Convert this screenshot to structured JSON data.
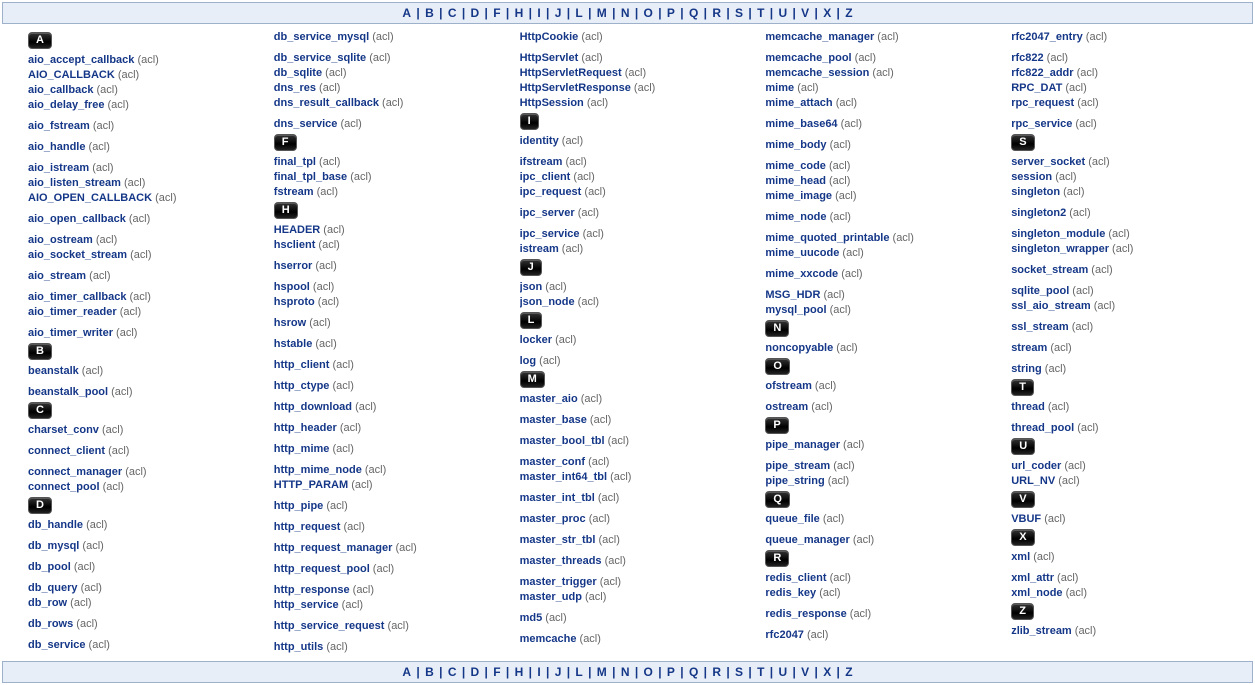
{
  "nav_letters": [
    "A",
    "B",
    "C",
    "D",
    "F",
    "H",
    "I",
    "J",
    "L",
    "M",
    "N",
    "O",
    "P",
    "Q",
    "R",
    "S",
    "T",
    "U",
    "V",
    "X",
    "Z"
  ],
  "columns": [
    [
      {
        "type": "letter",
        "text": "A"
      },
      {
        "type": "entry",
        "name": "aio_accept_callback",
        "ns": "acl"
      },
      {
        "type": "entry",
        "name": "AIO_CALLBACK",
        "ns": "acl"
      },
      {
        "type": "entry",
        "name": "aio_callback",
        "ns": "acl"
      },
      {
        "type": "entry",
        "name": "aio_delay_free",
        "ns": "acl"
      },
      {
        "type": "spacer"
      },
      {
        "type": "entry",
        "name": "aio_fstream",
        "ns": "acl"
      },
      {
        "type": "spacer"
      },
      {
        "type": "entry",
        "name": "aio_handle",
        "ns": "acl"
      },
      {
        "type": "spacer"
      },
      {
        "type": "entry",
        "name": "aio_istream",
        "ns": "acl"
      },
      {
        "type": "entry",
        "name": "aio_listen_stream",
        "ns": "acl"
      },
      {
        "type": "entry",
        "name": "AIO_OPEN_CALLBACK",
        "ns": "acl"
      },
      {
        "type": "spacer"
      },
      {
        "type": "entry",
        "name": "aio_open_callback",
        "ns": "acl"
      },
      {
        "type": "spacer"
      },
      {
        "type": "entry",
        "name": "aio_ostream",
        "ns": "acl"
      },
      {
        "type": "entry",
        "name": "aio_socket_stream",
        "ns": "acl"
      },
      {
        "type": "spacer"
      },
      {
        "type": "entry",
        "name": "aio_stream",
        "ns": "acl"
      },
      {
        "type": "spacer"
      },
      {
        "type": "entry",
        "name": "aio_timer_callback",
        "ns": "acl"
      },
      {
        "type": "entry",
        "name": "aio_timer_reader",
        "ns": "acl"
      },
      {
        "type": "spacer"
      },
      {
        "type": "entry",
        "name": "aio_timer_writer",
        "ns": "acl"
      },
      {
        "type": "letter",
        "text": "B"
      },
      {
        "type": "entry",
        "name": "beanstalk",
        "ns": "acl"
      },
      {
        "type": "spacer"
      },
      {
        "type": "entry",
        "name": "beanstalk_pool",
        "ns": "acl"
      },
      {
        "type": "letter",
        "text": "C"
      },
      {
        "type": "entry",
        "name": "charset_conv",
        "ns": "acl"
      },
      {
        "type": "spacer"
      },
      {
        "type": "entry",
        "name": "connect_client",
        "ns": "acl"
      },
      {
        "type": "spacer"
      },
      {
        "type": "entry",
        "name": "connect_manager",
        "ns": "acl"
      },
      {
        "type": "entry",
        "name": "connect_pool",
        "ns": "acl"
      },
      {
        "type": "letter",
        "text": "D"
      },
      {
        "type": "entry",
        "name": "db_handle",
        "ns": "acl"
      },
      {
        "type": "spacer"
      },
      {
        "type": "entry",
        "name": "db_mysql",
        "ns": "acl"
      },
      {
        "type": "spacer"
      },
      {
        "type": "entry",
        "name": "db_pool",
        "ns": "acl"
      },
      {
        "type": "spacer"
      },
      {
        "type": "entry",
        "name": "db_query",
        "ns": "acl"
      },
      {
        "type": "entry",
        "name": "db_row",
        "ns": "acl"
      },
      {
        "type": "spacer"
      },
      {
        "type": "entry",
        "name": "db_rows",
        "ns": "acl"
      },
      {
        "type": "spacer"
      },
      {
        "type": "entry",
        "name": "db_service",
        "ns": "acl"
      }
    ],
    [
      {
        "type": "entry",
        "name": "db_service_mysql",
        "ns": "acl"
      },
      {
        "type": "spacer"
      },
      {
        "type": "entry",
        "name": "db_service_sqlite",
        "ns": "acl"
      },
      {
        "type": "entry",
        "name": "db_sqlite",
        "ns": "acl"
      },
      {
        "type": "entry",
        "name": "dns_res",
        "ns": "acl"
      },
      {
        "type": "entry",
        "name": "dns_result_callback",
        "ns": "acl"
      },
      {
        "type": "spacer"
      },
      {
        "type": "entry",
        "name": "dns_service",
        "ns": "acl"
      },
      {
        "type": "letter",
        "text": "F"
      },
      {
        "type": "entry",
        "name": "final_tpl",
        "ns": "acl"
      },
      {
        "type": "entry",
        "name": "final_tpl_base",
        "ns": "acl"
      },
      {
        "type": "entry",
        "name": "fstream",
        "ns": "acl"
      },
      {
        "type": "letter",
        "text": "H"
      },
      {
        "type": "entry",
        "name": "HEADER",
        "ns": "acl"
      },
      {
        "type": "entry",
        "name": "hsclient",
        "ns": "acl"
      },
      {
        "type": "spacer"
      },
      {
        "type": "entry",
        "name": "hserror",
        "ns": "acl"
      },
      {
        "type": "spacer"
      },
      {
        "type": "entry",
        "name": "hspool",
        "ns": "acl"
      },
      {
        "type": "entry",
        "name": "hsproto",
        "ns": "acl"
      },
      {
        "type": "spacer"
      },
      {
        "type": "entry",
        "name": "hsrow",
        "ns": "acl"
      },
      {
        "type": "spacer"
      },
      {
        "type": "entry",
        "name": "hstable",
        "ns": "acl"
      },
      {
        "type": "spacer"
      },
      {
        "type": "entry",
        "name": "http_client",
        "ns": "acl"
      },
      {
        "type": "spacer"
      },
      {
        "type": "entry",
        "name": "http_ctype",
        "ns": "acl"
      },
      {
        "type": "spacer"
      },
      {
        "type": "entry",
        "name": "http_download",
        "ns": "acl"
      },
      {
        "type": "spacer"
      },
      {
        "type": "entry",
        "name": "http_header",
        "ns": "acl"
      },
      {
        "type": "spacer"
      },
      {
        "type": "entry",
        "name": "http_mime",
        "ns": "acl"
      },
      {
        "type": "spacer"
      },
      {
        "type": "entry",
        "name": "http_mime_node",
        "ns": "acl"
      },
      {
        "type": "entry",
        "name": "HTTP_PARAM",
        "ns": "acl"
      },
      {
        "type": "spacer"
      },
      {
        "type": "entry",
        "name": "http_pipe",
        "ns": "acl"
      },
      {
        "type": "spacer"
      },
      {
        "type": "entry",
        "name": "http_request",
        "ns": "acl"
      },
      {
        "type": "spacer"
      },
      {
        "type": "entry",
        "name": "http_request_manager",
        "ns": "acl"
      },
      {
        "type": "spacer"
      },
      {
        "type": "entry",
        "name": "http_request_pool",
        "ns": "acl"
      },
      {
        "type": "spacer"
      },
      {
        "type": "entry",
        "name": "http_response",
        "ns": "acl"
      },
      {
        "type": "entry",
        "name": "http_service",
        "ns": "acl"
      },
      {
        "type": "spacer"
      },
      {
        "type": "entry",
        "name": "http_service_request",
        "ns": "acl"
      },
      {
        "type": "spacer"
      },
      {
        "type": "entry",
        "name": "http_utils",
        "ns": "acl"
      }
    ],
    [
      {
        "type": "entry",
        "name": "HttpCookie",
        "ns": "acl"
      },
      {
        "type": "spacer"
      },
      {
        "type": "entry",
        "name": "HttpServlet",
        "ns": "acl"
      },
      {
        "type": "entry",
        "name": "HttpServletRequest",
        "ns": "acl"
      },
      {
        "type": "entry",
        "name": "HttpServletResponse",
        "ns": "acl"
      },
      {
        "type": "entry",
        "name": "HttpSession",
        "ns": "acl"
      },
      {
        "type": "letter",
        "text": "I"
      },
      {
        "type": "entry",
        "name": "identity",
        "ns": "acl"
      },
      {
        "type": "spacer"
      },
      {
        "type": "entry",
        "name": "ifstream",
        "ns": "acl"
      },
      {
        "type": "entry",
        "name": "ipc_client",
        "ns": "acl"
      },
      {
        "type": "entry",
        "name": "ipc_request",
        "ns": "acl"
      },
      {
        "type": "spacer"
      },
      {
        "type": "entry",
        "name": "ipc_server",
        "ns": "acl"
      },
      {
        "type": "spacer"
      },
      {
        "type": "entry",
        "name": "ipc_service",
        "ns": "acl"
      },
      {
        "type": "entry",
        "name": "istream",
        "ns": "acl"
      },
      {
        "type": "letter",
        "text": "J"
      },
      {
        "type": "entry",
        "name": "json",
        "ns": "acl"
      },
      {
        "type": "entry",
        "name": "json_node",
        "ns": "acl"
      },
      {
        "type": "letter",
        "text": "L"
      },
      {
        "type": "entry",
        "name": "locker",
        "ns": "acl"
      },
      {
        "type": "spacer"
      },
      {
        "type": "entry",
        "name": "log",
        "ns": "acl"
      },
      {
        "type": "letter",
        "text": "M"
      },
      {
        "type": "entry",
        "name": "master_aio",
        "ns": "acl"
      },
      {
        "type": "spacer"
      },
      {
        "type": "entry",
        "name": "master_base",
        "ns": "acl"
      },
      {
        "type": "spacer"
      },
      {
        "type": "entry",
        "name": "master_bool_tbl",
        "ns": "acl"
      },
      {
        "type": "spacer"
      },
      {
        "type": "entry",
        "name": "master_conf",
        "ns": "acl"
      },
      {
        "type": "entry",
        "name": "master_int64_tbl",
        "ns": "acl"
      },
      {
        "type": "spacer"
      },
      {
        "type": "entry",
        "name": "master_int_tbl",
        "ns": "acl"
      },
      {
        "type": "spacer"
      },
      {
        "type": "entry",
        "name": "master_proc",
        "ns": "acl"
      },
      {
        "type": "spacer"
      },
      {
        "type": "entry",
        "name": "master_str_tbl",
        "ns": "acl"
      },
      {
        "type": "spacer"
      },
      {
        "type": "entry",
        "name": "master_threads",
        "ns": "acl"
      },
      {
        "type": "spacer"
      },
      {
        "type": "entry",
        "name": "master_trigger",
        "ns": "acl"
      },
      {
        "type": "entry",
        "name": "master_udp",
        "ns": "acl"
      },
      {
        "type": "spacer"
      },
      {
        "type": "entry",
        "name": "md5",
        "ns": "acl"
      },
      {
        "type": "spacer"
      },
      {
        "type": "entry",
        "name": "memcache",
        "ns": "acl"
      }
    ],
    [
      {
        "type": "entry",
        "name": "memcache_manager",
        "ns": "acl"
      },
      {
        "type": "spacer"
      },
      {
        "type": "entry",
        "name": "memcache_pool",
        "ns": "acl"
      },
      {
        "type": "entry",
        "name": "memcache_session",
        "ns": "acl"
      },
      {
        "type": "entry",
        "name": "mime",
        "ns": "acl"
      },
      {
        "type": "entry",
        "name": "mime_attach",
        "ns": "acl"
      },
      {
        "type": "spacer"
      },
      {
        "type": "entry",
        "name": "mime_base64",
        "ns": "acl"
      },
      {
        "type": "spacer"
      },
      {
        "type": "entry",
        "name": "mime_body",
        "ns": "acl"
      },
      {
        "type": "spacer"
      },
      {
        "type": "entry",
        "name": "mime_code",
        "ns": "acl"
      },
      {
        "type": "entry",
        "name": "mime_head",
        "ns": "acl"
      },
      {
        "type": "entry",
        "name": "mime_image",
        "ns": "acl"
      },
      {
        "type": "spacer"
      },
      {
        "type": "entry",
        "name": "mime_node",
        "ns": "acl"
      },
      {
        "type": "spacer"
      },
      {
        "type": "entry",
        "name": "mime_quoted_printable",
        "ns": "acl"
      },
      {
        "type": "entry",
        "name": "mime_uucode",
        "ns": "acl"
      },
      {
        "type": "spacer"
      },
      {
        "type": "entry",
        "name": "mime_xxcode",
        "ns": "acl"
      },
      {
        "type": "spacer"
      },
      {
        "type": "entry",
        "name": "MSG_HDR",
        "ns": "acl"
      },
      {
        "type": "entry",
        "name": "mysql_pool",
        "ns": "acl"
      },
      {
        "type": "letter",
        "text": "N"
      },
      {
        "type": "entry",
        "name": "noncopyable",
        "ns": "acl"
      },
      {
        "type": "letter",
        "text": "O"
      },
      {
        "type": "entry",
        "name": "ofstream",
        "ns": "acl"
      },
      {
        "type": "spacer"
      },
      {
        "type": "entry",
        "name": "ostream",
        "ns": "acl"
      },
      {
        "type": "letter",
        "text": "P"
      },
      {
        "type": "entry",
        "name": "pipe_manager",
        "ns": "acl"
      },
      {
        "type": "spacer"
      },
      {
        "type": "entry",
        "name": "pipe_stream",
        "ns": "acl"
      },
      {
        "type": "entry",
        "name": "pipe_string",
        "ns": "acl"
      },
      {
        "type": "letter",
        "text": "Q"
      },
      {
        "type": "entry",
        "name": "queue_file",
        "ns": "acl"
      },
      {
        "type": "spacer"
      },
      {
        "type": "entry",
        "name": "queue_manager",
        "ns": "acl"
      },
      {
        "type": "letter",
        "text": "R"
      },
      {
        "type": "entry",
        "name": "redis_client",
        "ns": "acl"
      },
      {
        "type": "entry",
        "name": "redis_key",
        "ns": "acl"
      },
      {
        "type": "spacer"
      },
      {
        "type": "entry",
        "name": "redis_response",
        "ns": "acl"
      },
      {
        "type": "spacer"
      },
      {
        "type": "entry",
        "name": "rfc2047",
        "ns": "acl"
      }
    ],
    [
      {
        "type": "entry",
        "name": "rfc2047_entry",
        "ns": "acl"
      },
      {
        "type": "spacer"
      },
      {
        "type": "entry",
        "name": "rfc822",
        "ns": "acl"
      },
      {
        "type": "entry",
        "name": "rfc822_addr",
        "ns": "acl"
      },
      {
        "type": "entry",
        "name": "RPC_DAT",
        "ns": "acl"
      },
      {
        "type": "entry",
        "name": "rpc_request",
        "ns": "acl"
      },
      {
        "type": "spacer"
      },
      {
        "type": "entry",
        "name": "rpc_service",
        "ns": "acl"
      },
      {
        "type": "letter",
        "text": "S"
      },
      {
        "type": "entry",
        "name": "server_socket",
        "ns": "acl"
      },
      {
        "type": "entry",
        "name": "session",
        "ns": "acl"
      },
      {
        "type": "entry",
        "name": "singleton",
        "ns": "acl"
      },
      {
        "type": "spacer"
      },
      {
        "type": "entry",
        "name": "singleton2",
        "ns": "acl"
      },
      {
        "type": "spacer"
      },
      {
        "type": "entry",
        "name": "singleton_module",
        "ns": "acl"
      },
      {
        "type": "entry",
        "name": "singleton_wrapper",
        "ns": "acl"
      },
      {
        "type": "spacer"
      },
      {
        "type": "entry",
        "name": "socket_stream",
        "ns": "acl"
      },
      {
        "type": "spacer"
      },
      {
        "type": "entry",
        "name": "sqlite_pool",
        "ns": "acl"
      },
      {
        "type": "entry",
        "name": "ssl_aio_stream",
        "ns": "acl"
      },
      {
        "type": "spacer"
      },
      {
        "type": "entry",
        "name": "ssl_stream",
        "ns": "acl"
      },
      {
        "type": "spacer"
      },
      {
        "type": "entry",
        "name": "stream",
        "ns": "acl"
      },
      {
        "type": "spacer"
      },
      {
        "type": "entry",
        "name": "string",
        "ns": "acl"
      },
      {
        "type": "letter",
        "text": "T"
      },
      {
        "type": "entry",
        "name": "thread",
        "ns": "acl"
      },
      {
        "type": "spacer"
      },
      {
        "type": "entry",
        "name": "thread_pool",
        "ns": "acl"
      },
      {
        "type": "letter",
        "text": "U"
      },
      {
        "type": "entry",
        "name": "url_coder",
        "ns": "acl"
      },
      {
        "type": "entry",
        "name": "URL_NV",
        "ns": "acl"
      },
      {
        "type": "letter",
        "text": "V"
      },
      {
        "type": "entry",
        "name": "VBUF",
        "ns": "acl"
      },
      {
        "type": "letter",
        "text": "X"
      },
      {
        "type": "entry",
        "name": "xml",
        "ns": "acl"
      },
      {
        "type": "spacer"
      },
      {
        "type": "entry",
        "name": "xml_attr",
        "ns": "acl"
      },
      {
        "type": "entry",
        "name": "xml_node",
        "ns": "acl"
      },
      {
        "type": "letter",
        "text": "Z"
      },
      {
        "type": "entry",
        "name": "zlib_stream",
        "ns": "acl"
      }
    ]
  ]
}
